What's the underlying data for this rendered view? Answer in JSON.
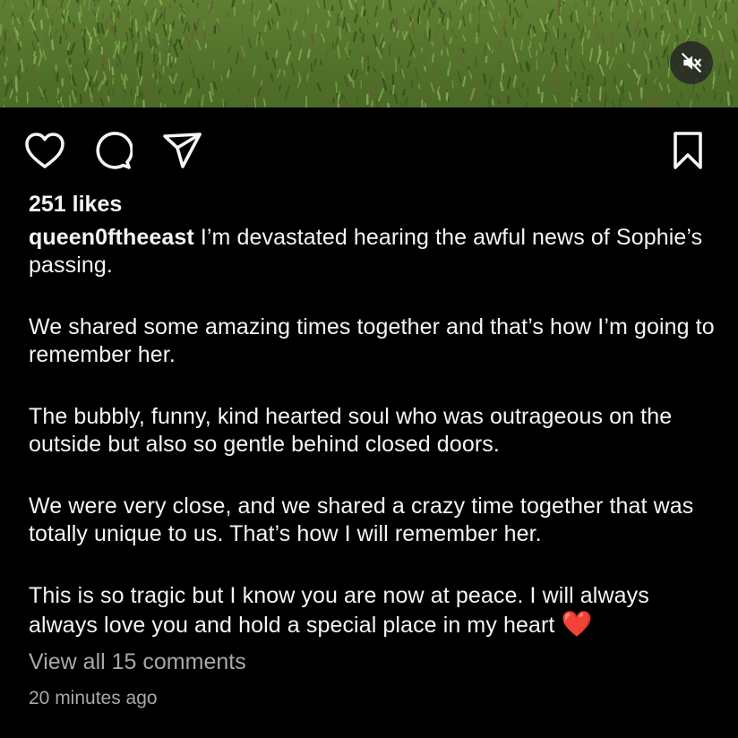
{
  "post": {
    "media": {
      "description_icon": "muted-speaker-icon",
      "colors": {
        "grass_dark": "#3d5a1f",
        "grass_light": "#7fa24a",
        "leaf": "#6b5a3a"
      }
    },
    "actions": {
      "like_icon": "heart-outline-icon",
      "comment_icon": "comment-bubble-icon",
      "share_icon": "paper-plane-icon",
      "save_icon": "bookmark-icon"
    },
    "likes": "251 likes",
    "caption": {
      "username": "queen0ftheeast",
      "paragraphs": [
        "I’m devastated hearing the awful news of Sophie’s passing.",
        "We shared some amazing times together and that’s how I’m going to remember her.",
        "The bubbly, funny, kind hearted soul who was outrageous on the outside but also so gentle behind closed doors.",
        "We were very close, and we shared a crazy time together that was totally unique to us. That’s how I will remember her.",
        "This is so tragic but I know you are now at peace. I will always always love you and hold a special place in my heart"
      ],
      "emoji": "❤️"
    },
    "view_comments": "View all 15 comments",
    "timestamp": "20 minutes ago"
  },
  "theme": {
    "background": "#000000",
    "text_primary": "#f5f5f5",
    "text_secondary": "#a8a8a8",
    "emoji_red": "#e8112d"
  }
}
